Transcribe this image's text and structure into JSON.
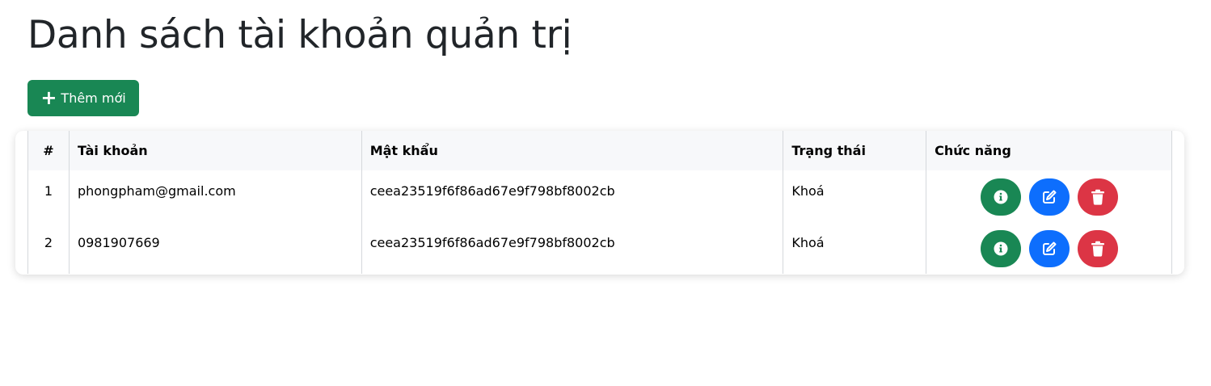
{
  "page": {
    "title": "Danh sách tài khoản quản trị"
  },
  "toolbar": {
    "add_label": "Thêm mới",
    "add_color": "#198754"
  },
  "table": {
    "headers": [
      "#",
      "Tài khoản",
      "Mật khẩu",
      "Trạng thái",
      "Chức năng"
    ],
    "rows": [
      {
        "index": "1",
        "account": "phongpham@gmail.com",
        "password": "ceea23519f6f86ad67e9f798bf8002cb",
        "status": "Khoá"
      },
      {
        "index": "2",
        "account": "0981907669",
        "password": "ceea23519f6f86ad67e9f798bf8002cb",
        "status": "Khoá"
      }
    ],
    "actions": [
      {
        "icon": "info-circle-icon",
        "color": "#198754"
      },
      {
        "icon": "edit-icon",
        "color": "#0d6efd"
      },
      {
        "icon": "trash-icon",
        "color": "#dc3545"
      }
    ]
  }
}
